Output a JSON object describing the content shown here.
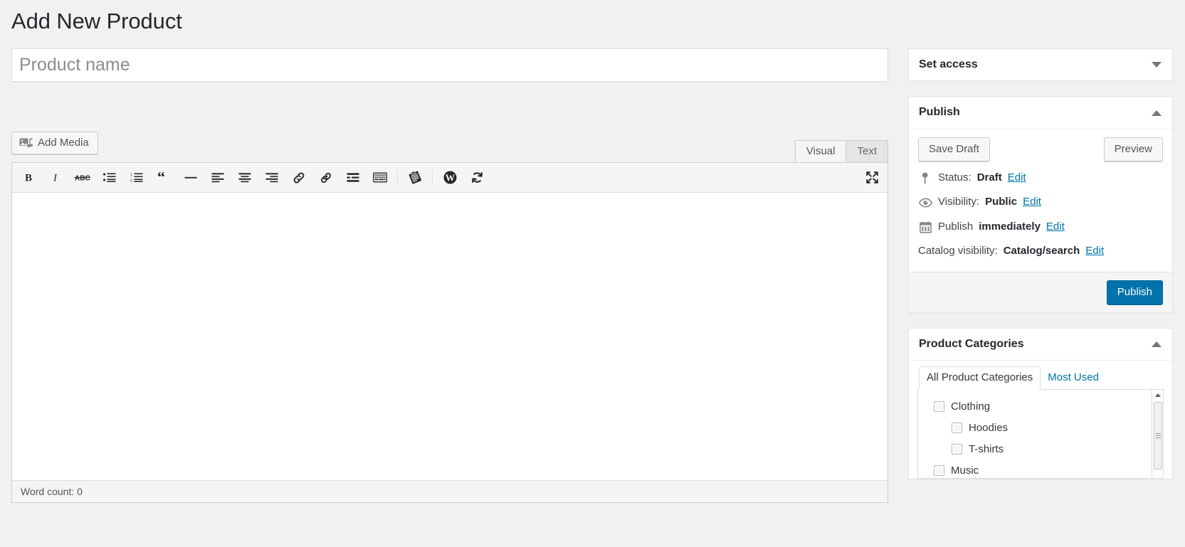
{
  "page": {
    "title": "Add New Product"
  },
  "product_title_field": {
    "value": "",
    "placeholder": "Product name"
  },
  "editor": {
    "add_media_label": "Add Media",
    "add_media_icon": "media-photo-music-icon",
    "tabs": [
      {
        "label": "Visual",
        "active": true
      },
      {
        "label": "Text",
        "active": false
      }
    ],
    "toolbar": [
      {
        "name": "bold-icon",
        "title": "Bold"
      },
      {
        "name": "italic-icon",
        "title": "Italic"
      },
      {
        "name": "strikethrough-icon",
        "title": "Strikethrough"
      },
      {
        "name": "bulleted-list-icon",
        "title": "Bulleted list"
      },
      {
        "name": "numbered-list-icon",
        "title": "Numbered list"
      },
      {
        "name": "blockquote-icon",
        "title": "Blockquote"
      },
      {
        "name": "horizontal-rule-icon",
        "title": "Horizontal line"
      },
      {
        "name": "align-left-icon",
        "title": "Align left"
      },
      {
        "name": "align-center-icon",
        "title": "Align center"
      },
      {
        "name": "align-right-icon",
        "title": "Align right"
      },
      {
        "name": "insert-link-icon",
        "title": "Insert/edit link"
      },
      {
        "name": "unlink-icon",
        "title": "Remove link"
      },
      {
        "name": "read-more-icon",
        "title": "Insert Read More tag"
      },
      {
        "name": "keyboard-shortcuts-icon",
        "title": "Keyboard shortcuts"
      },
      {
        "name": "paste-as-text-icon",
        "title": "Paste as text"
      },
      {
        "name": "wordpress-help-icon",
        "title": "Help"
      },
      {
        "name": "refresh-icon",
        "title": "Refresh"
      },
      {
        "name": "fullscreen-icon",
        "title": "Distraction-free writing mode"
      }
    ],
    "body_value": "",
    "word_count_label": "Word count: 0"
  },
  "sidebar": {
    "set_access": {
      "title": "Set access",
      "collapsed": true,
      "toggle_icon": "chevron-down-icon"
    },
    "publish": {
      "title": "Publish",
      "collapsed": false,
      "toggle_icon": "chevron-up-icon",
      "save_draft_label": "Save Draft",
      "preview_label": "Preview",
      "publish_label": "Publish",
      "rows": [
        {
          "icon": "pin-icon",
          "label": "Status:",
          "value": "Draft",
          "edit_label": "Edit",
          "has_icon": true
        },
        {
          "icon": "eye-icon",
          "label": "Visibility:",
          "value": "Public",
          "edit_label": "Edit",
          "has_icon": true
        },
        {
          "icon": "calendar-icon",
          "label": "Publish",
          "value": "immediately",
          "edit_label": "Edit",
          "has_icon": true
        },
        {
          "icon": "",
          "label": "Catalog visibility:",
          "value": "Catalog/search",
          "edit_label": "Edit",
          "has_icon": false
        }
      ]
    },
    "product_categories": {
      "title": "Product Categories",
      "collapsed": false,
      "toggle_icon": "chevron-up-icon",
      "tabs": [
        {
          "label": "All Product Categories",
          "active": true
        },
        {
          "label": "Most Used",
          "active": false
        }
      ],
      "items": [
        {
          "label": "Clothing",
          "level": 0,
          "checked": false
        },
        {
          "label": "Hoodies",
          "level": 1,
          "checked": false
        },
        {
          "label": "T-shirts",
          "level": 1,
          "checked": false
        },
        {
          "label": "Music",
          "level": 0,
          "checked": false
        }
      ],
      "scrollbar": {
        "name": "categories-scrollbar"
      }
    }
  },
  "colors": {
    "accent": "#0073aa",
    "page_bg": "#f1f1f1",
    "panel_bg": "#ffffff",
    "text": "#23282d",
    "muted": "#82878c"
  }
}
